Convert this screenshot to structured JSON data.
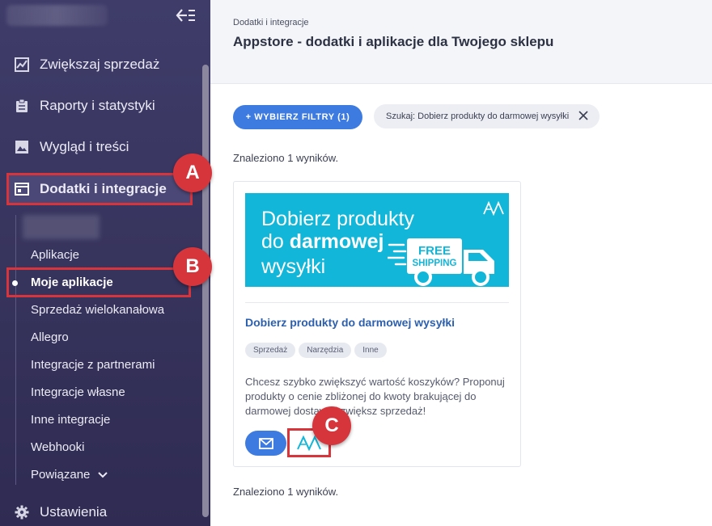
{
  "sidebar": {
    "menu": [
      {
        "label": "Zwiększaj sprzedaż",
        "icon": "chart-icon"
      },
      {
        "label": "Raporty i statystyki",
        "icon": "clipboard-icon"
      },
      {
        "label": "Wygląd i treści",
        "icon": "image-icon"
      },
      {
        "label": "Dodatki i integracje",
        "icon": "window-icon"
      }
    ],
    "submenu": [
      {
        "label": "Aplikacje"
      },
      {
        "label": "Moje aplikacje"
      },
      {
        "label": "Sprzedaż wielokanałowa"
      },
      {
        "label": "Allegro"
      },
      {
        "label": "Integracje z partnerami"
      },
      {
        "label": "Integracje własne"
      },
      {
        "label": "Inne integracje"
      },
      {
        "label": "Webhooki"
      },
      {
        "label": "Powiązane"
      }
    ],
    "settings_label": "Ustawienia"
  },
  "annotations": {
    "a": "A",
    "b": "B",
    "c": "C"
  },
  "header": {
    "breadcrumb": "Dodatki i integracje",
    "title": "Appstore - dodatki i aplikacje dla Twojego sklepu"
  },
  "filters": {
    "button_label": "+ WYBIERZ FILTRY (1)",
    "chip_label": "Szukaj: Dobierz produkty do darmowej wysyłki"
  },
  "results": {
    "found_top": "Znaleziono 1 wyników.",
    "found_bottom": "Znaleziono 1 wyników."
  },
  "card": {
    "banner": {
      "line1": "Dobierz produkty",
      "line2_prefix": "do ",
      "line2_bold": "darmowej",
      "line3": "wysyłki",
      "truck_text_1": "FREE",
      "truck_text_2": "SHIPPING"
    },
    "title": "Dobierz produkty do darmowej wysyłki",
    "tags": [
      "Sprzedaż",
      "Narzędzia",
      "Inne"
    ],
    "description": "Chcesz szybko zwiększyć wartość koszyków? Proponuj produkty o cenie zbliżonej do kwoty brakującej do darmowej dostawy i zwiększ sprzedaż!"
  },
  "colors": {
    "sidebar": "#3f3c6a",
    "accent": "#3d7be0",
    "annotation": "#d7343b",
    "banner": "#11b6d8"
  }
}
